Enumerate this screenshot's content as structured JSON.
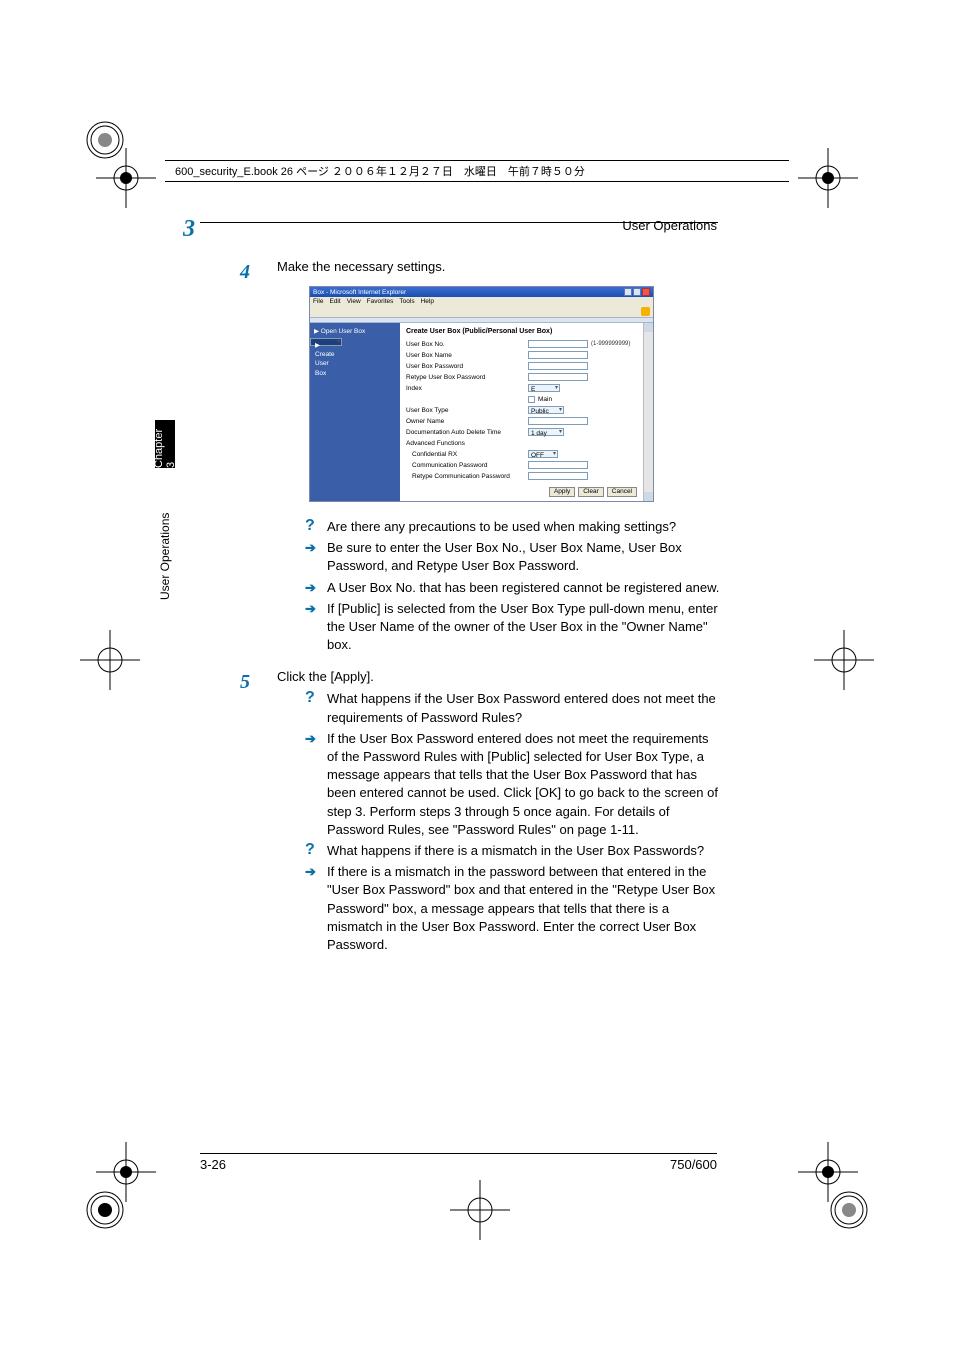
{
  "topline": "600_security_E.book  26 ページ  ２００６年１２月２７日　水曜日　午前７時５０分",
  "header": {
    "chapterNum": "3",
    "section": "User Operations"
  },
  "sidetab": "Chapter 3",
  "sidecaption": "User Operations",
  "steps": {
    "s4": {
      "num": "4",
      "text": "Make the necessary settings.",
      "qa": {
        "q": "Are there any precautions to be used when making settings?",
        "a1": "Be sure to enter the User Box No., User Box Name, User Box Password, and Retype User Box Password.",
        "a2": "A User Box No. that has been registered cannot be registered anew.",
        "a3": "If [Public] is selected from the User Box Type pull-down menu, enter the User Name of the owner of the User Box in the \"Owner Name\" box."
      }
    },
    "s5": {
      "num": "5",
      "text": "Click the [Apply].",
      "qa1": {
        "q": "What happens if the User Box Password entered does not meet the requirements of Password Rules?",
        "a": "If the User Box Password entered does not meet the requirements of the Password Rules with [Public] selected for User Box Type, a message appears that tells that the User Box Password that has been entered cannot be used. Click [OK] to go back to the screen of step 3. Perform steps 3 through 5 once again. For details of Password Rules, see \"Password Rules\" on page 1-11."
      },
      "qa2": {
        "q": "What happens if there is a mismatch in the User Box Passwords?",
        "a": "If there is a mismatch in the password between that entered in the \"User Box Password\" box and that entered in the \"Retype User Box Password\" box, a message appears that tells that there is a mismatch in the User Box Password. Enter the correct User Box Password."
      }
    }
  },
  "browser": {
    "title": "Box - Microsoft Internet Explorer",
    "menu": [
      "File",
      "Edit",
      "View",
      "Favorites",
      "Tools",
      "Help"
    ],
    "nav": {
      "open": "▶ Open User Box",
      "create": "▶ Create User Box"
    },
    "form": {
      "title": "Create User Box (Public/Personal User Box)",
      "ubno": "User Box No.",
      "range": "(1-999999999)",
      "ubname": "User Box Name",
      "ubpw": "User Box Password",
      "rubpw": "Retype User Box Password",
      "index": "Index",
      "indexVal": "E",
      "main": "Main",
      "ubtype": "User Box Type",
      "ubtypeVal": "Public",
      "owner": "Owner Name",
      "autodel": "Documentation Auto Delete Time",
      "autodelVal": "1 day",
      "adv": "Advanced Functions",
      "conf": "Confidential RX",
      "confVal": "OFF",
      "commpw": "Communication Password",
      "rcommpw": "Retype Communication Password",
      "apply": "Apply",
      "clear": "Clear",
      "cancel": "Cancel"
    }
  },
  "footer": {
    "left": "3-26",
    "right": "750/600"
  }
}
